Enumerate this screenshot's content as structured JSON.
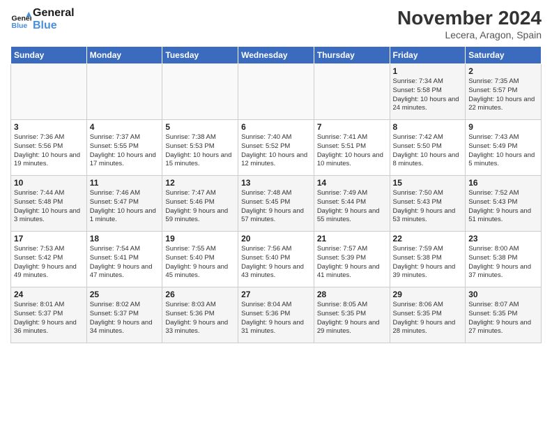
{
  "logo": {
    "text_general": "General",
    "text_blue": "Blue"
  },
  "header": {
    "month": "November 2024",
    "location": "Lecera, Aragon, Spain"
  },
  "weekdays": [
    "Sunday",
    "Monday",
    "Tuesday",
    "Wednesday",
    "Thursday",
    "Friday",
    "Saturday"
  ],
  "weeks": [
    [
      {
        "day": "",
        "detail": ""
      },
      {
        "day": "",
        "detail": ""
      },
      {
        "day": "",
        "detail": ""
      },
      {
        "day": "",
        "detail": ""
      },
      {
        "day": "",
        "detail": ""
      },
      {
        "day": "1",
        "detail": "Sunrise: 7:34 AM\nSunset: 5:58 PM\nDaylight: 10 hours and 24 minutes."
      },
      {
        "day": "2",
        "detail": "Sunrise: 7:35 AM\nSunset: 5:57 PM\nDaylight: 10 hours and 22 minutes."
      }
    ],
    [
      {
        "day": "3",
        "detail": "Sunrise: 7:36 AM\nSunset: 5:56 PM\nDaylight: 10 hours and 19 minutes."
      },
      {
        "day": "4",
        "detail": "Sunrise: 7:37 AM\nSunset: 5:55 PM\nDaylight: 10 hours and 17 minutes."
      },
      {
        "day": "5",
        "detail": "Sunrise: 7:38 AM\nSunset: 5:53 PM\nDaylight: 10 hours and 15 minutes."
      },
      {
        "day": "6",
        "detail": "Sunrise: 7:40 AM\nSunset: 5:52 PM\nDaylight: 10 hours and 12 minutes."
      },
      {
        "day": "7",
        "detail": "Sunrise: 7:41 AM\nSunset: 5:51 PM\nDaylight: 10 hours and 10 minutes."
      },
      {
        "day": "8",
        "detail": "Sunrise: 7:42 AM\nSunset: 5:50 PM\nDaylight: 10 hours and 8 minutes."
      },
      {
        "day": "9",
        "detail": "Sunrise: 7:43 AM\nSunset: 5:49 PM\nDaylight: 10 hours and 5 minutes."
      }
    ],
    [
      {
        "day": "10",
        "detail": "Sunrise: 7:44 AM\nSunset: 5:48 PM\nDaylight: 10 hours and 3 minutes."
      },
      {
        "day": "11",
        "detail": "Sunrise: 7:46 AM\nSunset: 5:47 PM\nDaylight: 10 hours and 1 minute."
      },
      {
        "day": "12",
        "detail": "Sunrise: 7:47 AM\nSunset: 5:46 PM\nDaylight: 9 hours and 59 minutes."
      },
      {
        "day": "13",
        "detail": "Sunrise: 7:48 AM\nSunset: 5:45 PM\nDaylight: 9 hours and 57 minutes."
      },
      {
        "day": "14",
        "detail": "Sunrise: 7:49 AM\nSunset: 5:44 PM\nDaylight: 9 hours and 55 minutes."
      },
      {
        "day": "15",
        "detail": "Sunrise: 7:50 AM\nSunset: 5:43 PM\nDaylight: 9 hours and 53 minutes."
      },
      {
        "day": "16",
        "detail": "Sunrise: 7:52 AM\nSunset: 5:43 PM\nDaylight: 9 hours and 51 minutes."
      }
    ],
    [
      {
        "day": "17",
        "detail": "Sunrise: 7:53 AM\nSunset: 5:42 PM\nDaylight: 9 hours and 49 minutes."
      },
      {
        "day": "18",
        "detail": "Sunrise: 7:54 AM\nSunset: 5:41 PM\nDaylight: 9 hours and 47 minutes."
      },
      {
        "day": "19",
        "detail": "Sunrise: 7:55 AM\nSunset: 5:40 PM\nDaylight: 9 hours and 45 minutes."
      },
      {
        "day": "20",
        "detail": "Sunrise: 7:56 AM\nSunset: 5:40 PM\nDaylight: 9 hours and 43 minutes."
      },
      {
        "day": "21",
        "detail": "Sunrise: 7:57 AM\nSunset: 5:39 PM\nDaylight: 9 hours and 41 minutes."
      },
      {
        "day": "22",
        "detail": "Sunrise: 7:59 AM\nSunset: 5:38 PM\nDaylight: 9 hours and 39 minutes."
      },
      {
        "day": "23",
        "detail": "Sunrise: 8:00 AM\nSunset: 5:38 PM\nDaylight: 9 hours and 37 minutes."
      }
    ],
    [
      {
        "day": "24",
        "detail": "Sunrise: 8:01 AM\nSunset: 5:37 PM\nDaylight: 9 hours and 36 minutes."
      },
      {
        "day": "25",
        "detail": "Sunrise: 8:02 AM\nSunset: 5:37 PM\nDaylight: 9 hours and 34 minutes."
      },
      {
        "day": "26",
        "detail": "Sunrise: 8:03 AM\nSunset: 5:36 PM\nDaylight: 9 hours and 33 minutes."
      },
      {
        "day": "27",
        "detail": "Sunrise: 8:04 AM\nSunset: 5:36 PM\nDaylight: 9 hours and 31 minutes."
      },
      {
        "day": "28",
        "detail": "Sunrise: 8:05 AM\nSunset: 5:35 PM\nDaylight: 9 hours and 29 minutes."
      },
      {
        "day": "29",
        "detail": "Sunrise: 8:06 AM\nSunset: 5:35 PM\nDaylight: 9 hours and 28 minutes."
      },
      {
        "day": "30",
        "detail": "Sunrise: 8:07 AM\nSunset: 5:35 PM\nDaylight: 9 hours and 27 minutes."
      }
    ]
  ]
}
